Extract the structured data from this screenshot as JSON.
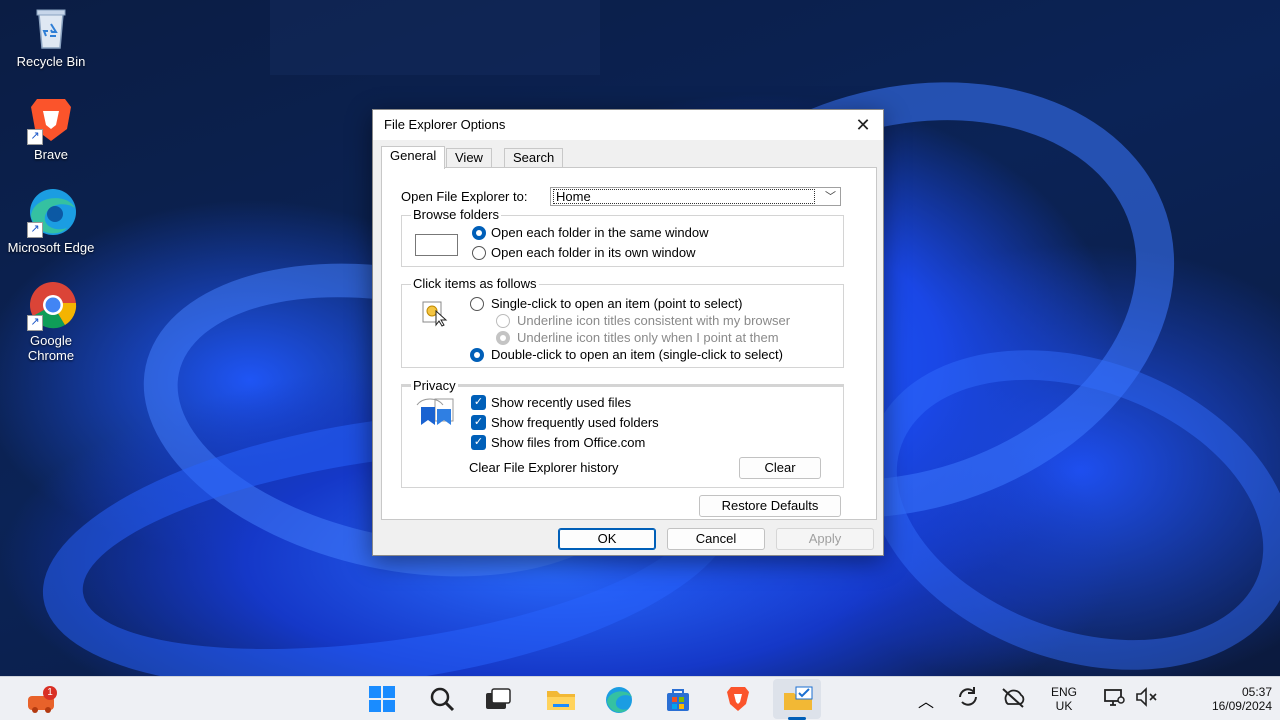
{
  "desktop": {
    "icons": [
      {
        "label": "Recycle Bin",
        "icon": "recycle-bin-icon"
      },
      {
        "label": "Brave",
        "icon": "brave-icon"
      },
      {
        "label": "Microsoft Edge",
        "icon": "edge-icon"
      },
      {
        "label": "Google Chrome",
        "icon": "chrome-icon"
      }
    ]
  },
  "dialog": {
    "title": "File Explorer Options",
    "close_icon": "close-icon",
    "tabs": [
      {
        "label": "General",
        "active": true
      },
      {
        "label": "View",
        "active": false
      },
      {
        "label": "Search",
        "active": false
      }
    ],
    "open_to": {
      "label": "Open File Explorer to:",
      "value": "Home"
    },
    "browse_folders": {
      "title": "Browse folders",
      "options": [
        {
          "label": "Open each folder in the same window",
          "checked": true
        },
        {
          "label": "Open each folder in its own window",
          "checked": false
        }
      ]
    },
    "click_items": {
      "title": "Click items as follows",
      "single_click": {
        "label": "Single-click to open an item (point to select)",
        "checked": false
      },
      "sub_options": [
        {
          "label": "Underline icon titles consistent with my browser",
          "checked": false,
          "enabled": false
        },
        {
          "label": "Underline icon titles only when I point at them",
          "checked": true,
          "enabled": false
        }
      ],
      "double_click": {
        "label": "Double-click to open an item (single-click to select)",
        "checked": true
      }
    },
    "privacy": {
      "title": "Privacy",
      "checkboxes": [
        {
          "label": "Show recently used files",
          "checked": true
        },
        {
          "label": "Show frequently used folders",
          "checked": true
        },
        {
          "label": "Show files from Office.com",
          "checked": true
        }
      ],
      "clear_label": "Clear File Explorer history",
      "clear_button": "Clear"
    },
    "restore_defaults": "Restore Defaults",
    "buttons": {
      "ok": "OK",
      "cancel": "Cancel",
      "apply": "Apply"
    }
  },
  "taskbar": {
    "notification_badge": "1",
    "tray": {
      "language_line1": "ENG",
      "language_line2": "UK",
      "time": "05:37",
      "date": "16/09/2024"
    }
  },
  "colors": {
    "accent": "#005fb8",
    "taskbar": "#eef0f4"
  }
}
